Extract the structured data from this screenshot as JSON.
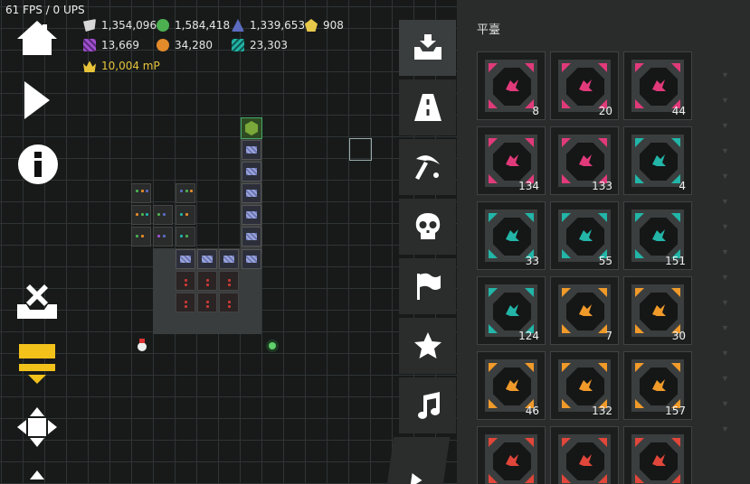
{
  "hud": {
    "fps_text": "61 FPS / 0 UPS",
    "resources": [
      {
        "icon": "ore-white-icon",
        "value": "1,354,096",
        "color": "#d8d8d8"
      },
      {
        "icon": "ore-green-icon",
        "value": "1,584,418",
        "color": "#4caf50"
      },
      {
        "icon": "ore-blue-icon",
        "value": "1,339,653",
        "color": "#5c6bc0"
      },
      {
        "icon": "ore-gold-icon",
        "value": "908",
        "color": "#e8c84a"
      },
      {
        "icon": "ore-purple-icon",
        "value": "13,669",
        "color": "#a050d0"
      },
      {
        "icon": "ore-orange-icon",
        "value": "34,280",
        "color": "#e38a2a"
      },
      {
        "icon": "ore-teal-icon",
        "value": "23,303",
        "color": "#21b3a6"
      },
      {
        "icon": "crown-icon",
        "value": "10,004 mP",
        "color": "#e7c43a"
      }
    ]
  },
  "left_buttons": [
    {
      "name": "home-button",
      "icon": "home-icon"
    },
    {
      "name": "play-button",
      "icon": "play-icon"
    },
    {
      "name": "info-button",
      "icon": "info-icon"
    },
    {
      "name": "clear-stash-button",
      "icon": "tray-remove-icon"
    },
    {
      "name": "inventory-button",
      "icon": "tray-download-icon"
    },
    {
      "name": "move-button",
      "icon": "move-arrows-icon"
    }
  ],
  "tabs": [
    {
      "name": "tab-inventory",
      "icon": "tray-download-icon",
      "active": true
    },
    {
      "name": "tab-roads",
      "icon": "road-icon"
    },
    {
      "name": "tab-mining",
      "icon": "pickaxe-icon"
    },
    {
      "name": "tab-enemies",
      "icon": "skull-icon"
    },
    {
      "name": "tab-flags",
      "icon": "flag-icon"
    },
    {
      "name": "tab-favorites",
      "icon": "star-icon"
    },
    {
      "name": "tab-music",
      "icon": "music-note-icon"
    }
  ],
  "panel": {
    "title": "平臺",
    "slots": [
      {
        "count": "8",
        "color": "#e03a7a",
        "glyph": "rune-pink-icon"
      },
      {
        "count": "20",
        "color": "#e03a7a",
        "glyph": "rune-pink-icon"
      },
      {
        "count": "44",
        "color": "#e03a7a",
        "glyph": "rune-pink-icon"
      },
      {
        "count": "134",
        "color": "#e03a7a",
        "glyph": "rune-pink-icon"
      },
      {
        "count": "133",
        "color": "#e03a7a",
        "glyph": "rune-pink-icon"
      },
      {
        "count": "4",
        "color": "#22b5a8",
        "glyph": "rune-teal-icon"
      },
      {
        "count": "33",
        "color": "#22b5a8",
        "glyph": "rune-teal-icon"
      },
      {
        "count": "55",
        "color": "#22b5a8",
        "glyph": "rune-teal-icon"
      },
      {
        "count": "151",
        "color": "#22b5a8",
        "glyph": "rune-teal-icon"
      },
      {
        "count": "124",
        "color": "#22b5a8",
        "glyph": "rune-teal-icon"
      },
      {
        "count": "7",
        "color": "#f09a2a",
        "glyph": "rune-orange-icon"
      },
      {
        "count": "30",
        "color": "#f09a2a",
        "glyph": "rune-orange-icon"
      },
      {
        "count": "46",
        "color": "#f09a2a",
        "glyph": "rune-orange-icon"
      },
      {
        "count": "132",
        "color": "#f09a2a",
        "glyph": "rune-orange-icon"
      },
      {
        "count": "157",
        "color": "#f09a2a",
        "glyph": "rune-orange-icon"
      },
      {
        "count": "",
        "color": "#e0463a",
        "glyph": "fist-red-icon"
      },
      {
        "count": "",
        "color": "#e0463a",
        "glyph": "fist-red-icon"
      },
      {
        "count": "",
        "color": "#e0463a",
        "glyph": "fist-red-icon"
      }
    ]
  }
}
